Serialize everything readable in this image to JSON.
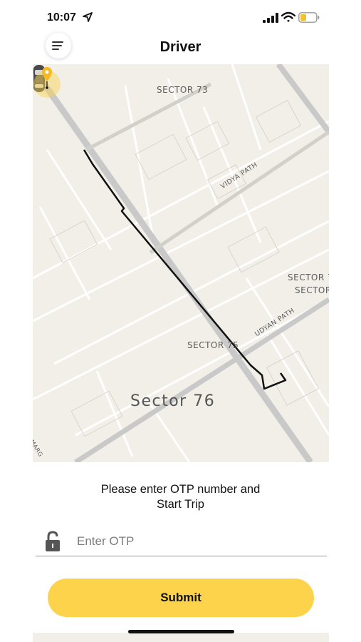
{
  "status_bar": {
    "time": "10:07",
    "icons": [
      "location-arrow-icon",
      "signal-icon",
      "wifi-icon",
      "battery-icon"
    ],
    "battery_color": "#f2c12e"
  },
  "header": {
    "title": "Driver",
    "menu_icon": "menu-icon"
  },
  "map": {
    "labels": {
      "sector_73": "SECTOR 73",
      "vidya_path": "VIDYA PATH",
      "sector_7_a": "SECTOR 7",
      "sector_7_b": "SECTOR",
      "udyan_path": "UDYAN PATH",
      "sector_75": "SECTOR 75",
      "sector_76": "Sector 76",
      "marg": "MARG"
    },
    "markers": [
      "car-icon",
      "destination-pin-icon"
    ],
    "colors": {
      "background": "#f1efe8",
      "major_road": "#c9c9c9",
      "route": "#111111",
      "destination": "#fcd34a"
    }
  },
  "otp": {
    "prompt_line1": "Please enter OTP number and",
    "prompt_line2": "Start Trip",
    "placeholder": "Enter OTP",
    "value": "",
    "icon": "lock-open-icon"
  },
  "submit": {
    "label": "Submit",
    "color": "#fcd34a"
  }
}
